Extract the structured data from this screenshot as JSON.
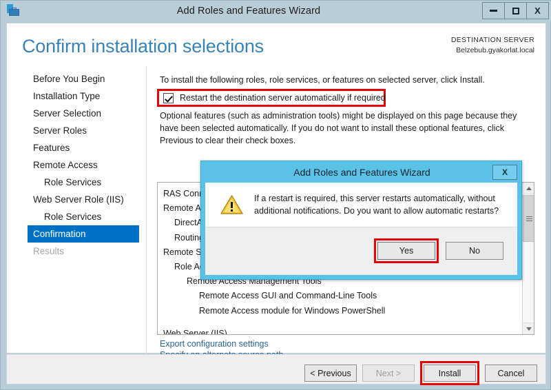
{
  "window": {
    "title": "Add Roles and Features Wizard",
    "icon": "server-manager-icon",
    "minimize_label": "Minimize",
    "maximize_label": "Maximize",
    "close_label": "X"
  },
  "header": {
    "page_title": "Confirm installation selections",
    "destination_label": "DESTINATION SERVER",
    "destination_server": "Belzebub.gyakorlat.local"
  },
  "sidebar": {
    "items": [
      {
        "label": "Before You Begin",
        "level": 0,
        "state": "normal"
      },
      {
        "label": "Installation Type",
        "level": 0,
        "state": "normal"
      },
      {
        "label": "Server Selection",
        "level": 0,
        "state": "normal"
      },
      {
        "label": "Server Roles",
        "level": 0,
        "state": "normal"
      },
      {
        "label": "Features",
        "level": 0,
        "state": "normal"
      },
      {
        "label": "Remote Access",
        "level": 0,
        "state": "normal"
      },
      {
        "label": "Role Services",
        "level": 1,
        "state": "normal"
      },
      {
        "label": "Web Server Role (IIS)",
        "level": 0,
        "state": "normal"
      },
      {
        "label": "Role Services",
        "level": 1,
        "state": "normal"
      },
      {
        "label": "Confirmation",
        "level": 0,
        "state": "active"
      },
      {
        "label": "Results",
        "level": 0,
        "state": "disabled"
      }
    ]
  },
  "main": {
    "intro_text": "To install the following roles, role services, or features on selected server, click Install.",
    "restart_checkbox_label": "Restart the destination server automatically if required",
    "restart_checkbox_checked": true,
    "optional_text": "Optional features (such as administration tools) might be displayed on this page because they have been selected automatically. If you do not want to install these optional features, click Previous to clear their check boxes.",
    "listbox_items": [
      {
        "label": "RAS Connection Manager Administration Kit (CMAK)",
        "level": 0
      },
      {
        "label": "Remote Access",
        "level": 0
      },
      {
        "label": "DirectAccess and VPN (RAS)",
        "level": 1
      },
      {
        "label": "Routing",
        "level": 1
      },
      {
        "label": "Remote Server Administration Tools",
        "level": 0
      },
      {
        "label": "Role Administration Tools",
        "level": 1
      },
      {
        "label": "Remote Access Management Tools",
        "level": 2
      },
      {
        "label": "Remote Access GUI and Command-Line Tools",
        "level": 3
      },
      {
        "label": "Remote Access module for Windows PowerShell",
        "level": 3
      },
      {
        "label": "Web Server (IIS)",
        "level": 0
      }
    ],
    "export_link": "Export configuration settings",
    "altpath_link": "Specify an alternate source path"
  },
  "footer": {
    "previous_label": "< Previous",
    "next_label": "Next >",
    "next_disabled": true,
    "install_label": "Install",
    "cancel_label": "Cancel"
  },
  "dialog": {
    "title": "Add Roles and Features Wizard",
    "close_label": "X",
    "icon": "warning-triangle-icon",
    "message": "If a restart is required, this server restarts automatically, without additional notifications. Do you want to allow automatic restarts?",
    "yes_label": "Yes",
    "no_label": "No"
  },
  "colors": {
    "accent_blue": "#0072c6",
    "title_blue": "#3a83b5",
    "dialog_blue": "#5bc2e7",
    "highlight_red": "#e60000",
    "window_chrome": "#b8cdd6"
  }
}
